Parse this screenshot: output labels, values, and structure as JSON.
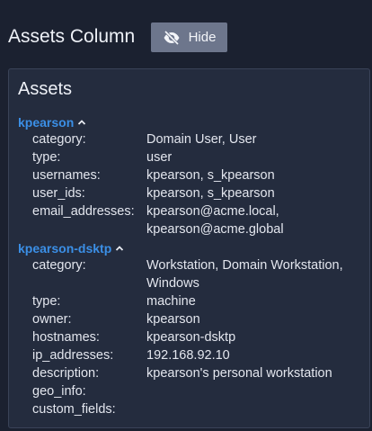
{
  "header": {
    "title": "Assets Column",
    "hide_button_label": "Hide",
    "hide_button_icon": "eye-slash-icon",
    "hide_button_color": "#6d768c"
  },
  "panel": {
    "title": "Assets",
    "link_color": "#3b8fe6",
    "assets": [
      {
        "name": "kpearson",
        "expand_icon": "chevron-up-icon",
        "fields": [
          {
            "key": "category:",
            "value": [
              "Domain User, User"
            ]
          },
          {
            "key": "type:",
            "value": [
              "user"
            ]
          },
          {
            "key": "usernames:",
            "value": [
              "kpearson, s_kpearson"
            ]
          },
          {
            "key": "user_ids:",
            "value": [
              "kpearson, s_kpearson"
            ]
          },
          {
            "key": "email_addresses:",
            "value": [
              "kpearson@acme.local,",
              "kpearson@acme.global"
            ]
          }
        ]
      },
      {
        "name": "kpearson-dsktp",
        "expand_icon": "chevron-up-icon",
        "fields": [
          {
            "key": "category:",
            "value": [
              "Workstation, Domain Workstation,",
              "Windows"
            ]
          },
          {
            "key": "type:",
            "value": [
              "machine"
            ]
          },
          {
            "key": "owner:",
            "value": [
              "kpearson"
            ]
          },
          {
            "key": "hostnames:",
            "value": [
              "kpearson-dsktp"
            ]
          },
          {
            "key": "ip_addresses:",
            "value": [
              "192.168.92.10"
            ]
          },
          {
            "key": "description:",
            "value": [
              "kpearson's personal workstation"
            ]
          },
          {
            "key": "geo_info:",
            "value": [
              ""
            ]
          },
          {
            "key": "custom_fields:",
            "value": [
              ""
            ]
          }
        ]
      }
    ]
  }
}
